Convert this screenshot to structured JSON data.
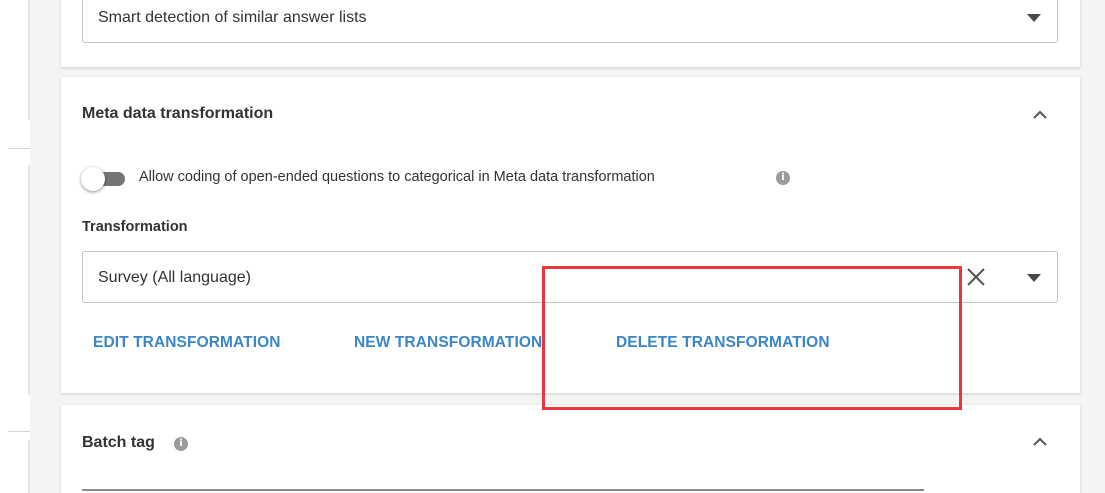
{
  "answer_list_select": {
    "value": "Smart detection of similar answer lists",
    "icons": {
      "dropdown": "caret-down-icon"
    }
  },
  "meta_section": {
    "title": "Meta data transformation",
    "collapse_icon": "chevron-up-icon",
    "toggle": {
      "label": "Allow coding of open-ended questions to categorical in Meta data transformation",
      "checked": false,
      "info_icon": "info-icon",
      "info_glyph": "i"
    },
    "transformation": {
      "label": "Transformation",
      "value": "Survey (All language)",
      "icons": {
        "clear": "close-icon",
        "dropdown": "caret-down-icon"
      }
    },
    "actions": {
      "edit": "EDIT TRANSFORMATION",
      "new": "NEW TRANSFORMATION",
      "delete": "DELETE TRANSFORMATION"
    }
  },
  "batch_section": {
    "title": "Batch tag",
    "info_icon": "info-icon",
    "info_glyph": "i",
    "collapse_icon": "chevron-up-icon"
  },
  "colors": {
    "accent": "#3a86c8",
    "highlight": "#e8383d",
    "toggle_track": "#757575"
  }
}
